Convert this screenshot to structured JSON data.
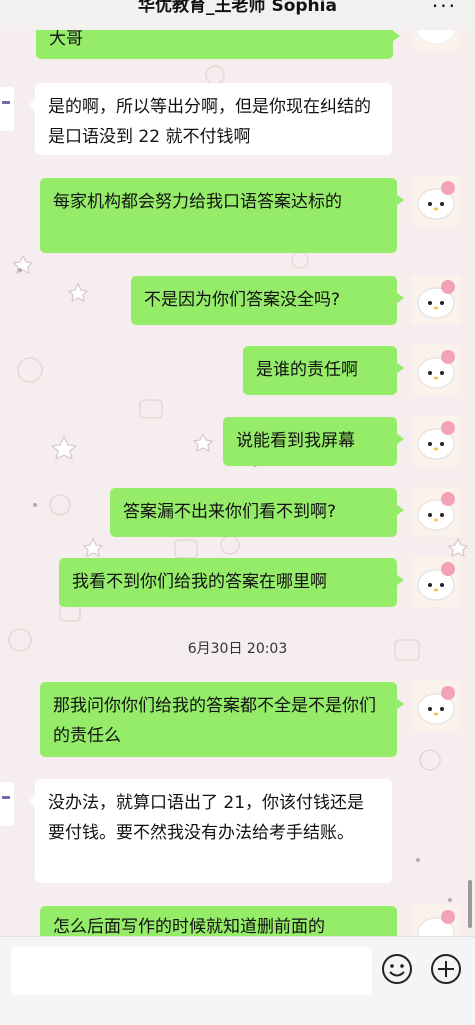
{
  "header": {
    "title": "华优教育_王老师 Sophia",
    "more_label": "···"
  },
  "messages": [
    {
      "from": "me",
      "text": "大哥"
    },
    {
      "from": "them",
      "text": "是的啊，所以等出分啊，但是你现在纠结的是口语没到 22 就不付钱啊"
    },
    {
      "from": "me",
      "text": "每家机构都会努力给我口语答案达标的"
    },
    {
      "from": "me",
      "text": "不是因为你们答案没全吗?"
    },
    {
      "from": "me",
      "text": "是谁的责任啊"
    },
    {
      "from": "me",
      "text": "说能看到我屏幕"
    },
    {
      "from": "me",
      "text": "答案漏不出来你们看不到啊?"
    },
    {
      "from": "me",
      "text": "我看不到你们给我的答案在哪里啊"
    },
    {
      "from": "me",
      "text": "那我问你你们给我的答案都不全是不是你们的责任么"
    },
    {
      "from": "them",
      "text": "没办法，就算口语出了 21，你该付钱还是要付钱。要不然我没有办法给考手结账。"
    },
    {
      "from": "me",
      "text": "怎么后面写作的时候就知道删前面的"
    }
  ],
  "timestamp": "6月30日 20:03",
  "input": {
    "placeholder": "",
    "emoji_icon": "smiley-icon",
    "plus_icon": "plus-icon"
  }
}
